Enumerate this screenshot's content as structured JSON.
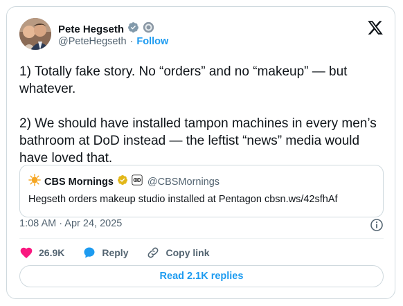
{
  "author": {
    "name": "Pete Hegseth",
    "handle": "@PeteHegseth",
    "separator": "·",
    "follow_label": "Follow"
  },
  "tweet": {
    "text": "1) Totally fake story. No “orders” and no “makeup” — but whatever.\n\n2) We should have installed tampon machines in every men’s bathroom at DoD instead — the leftist “news” media would have loved that."
  },
  "quote": {
    "name": "CBS Mornings",
    "handle": "@CBSMornings",
    "text": "Hegseth orders makeup studio installed at Pentagon cbsn.ws/42sfhAf"
  },
  "timestamp": "1:08 AM · Apr 24, 2025",
  "actions": {
    "like_count": "26.9K",
    "reply_label": "Reply",
    "copy_link_label": "Copy link"
  },
  "read_replies_label": "Read 2.1K replies",
  "colors": {
    "accent": "#1d9bf0",
    "like": "#f91880",
    "verified_gold": "#e2b719",
    "secondary_text": "#536471",
    "border": "#cfd9de"
  }
}
